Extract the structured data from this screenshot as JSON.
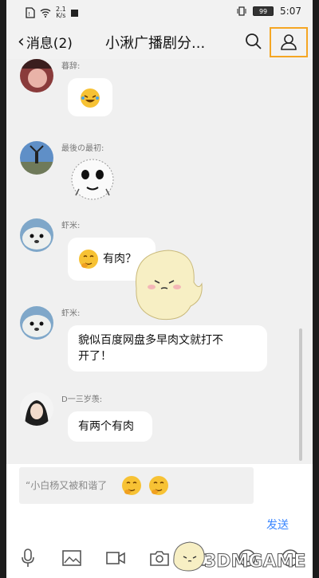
{
  "status_bar": {
    "speed_top": "2.1",
    "speed_bottom": "K/s",
    "battery": "99",
    "time": "5:07"
  },
  "nav": {
    "back_label": "消息(2)",
    "title": "小湫广播剧分..."
  },
  "messages": [
    {
      "sender": "暮辞:"
    },
    {
      "sender": "最後の最初:"
    },
    {
      "sender": "虾米:",
      "text": "有肉？"
    },
    {
      "sender": "虾米:",
      "text_line1": "貌似百度网盘多早肉文就打不",
      "text_line2": "开了！"
    },
    {
      "sender": "D一三岁羡:",
      "text": "有两个有肉"
    }
  ],
  "input": {
    "value": "“小白杨又被和谐了"
  },
  "send_label": "发送",
  "toolbar": [
    "mic-icon",
    "image-icon",
    "video-icon",
    "camera-icon",
    "folder-icon",
    "emoji-icon",
    "plus-icon"
  ],
  "watermark": {
    "text": "3DMGAME"
  },
  "colors": {
    "highlight": "#f5a623",
    "send": "#3a86ff"
  }
}
